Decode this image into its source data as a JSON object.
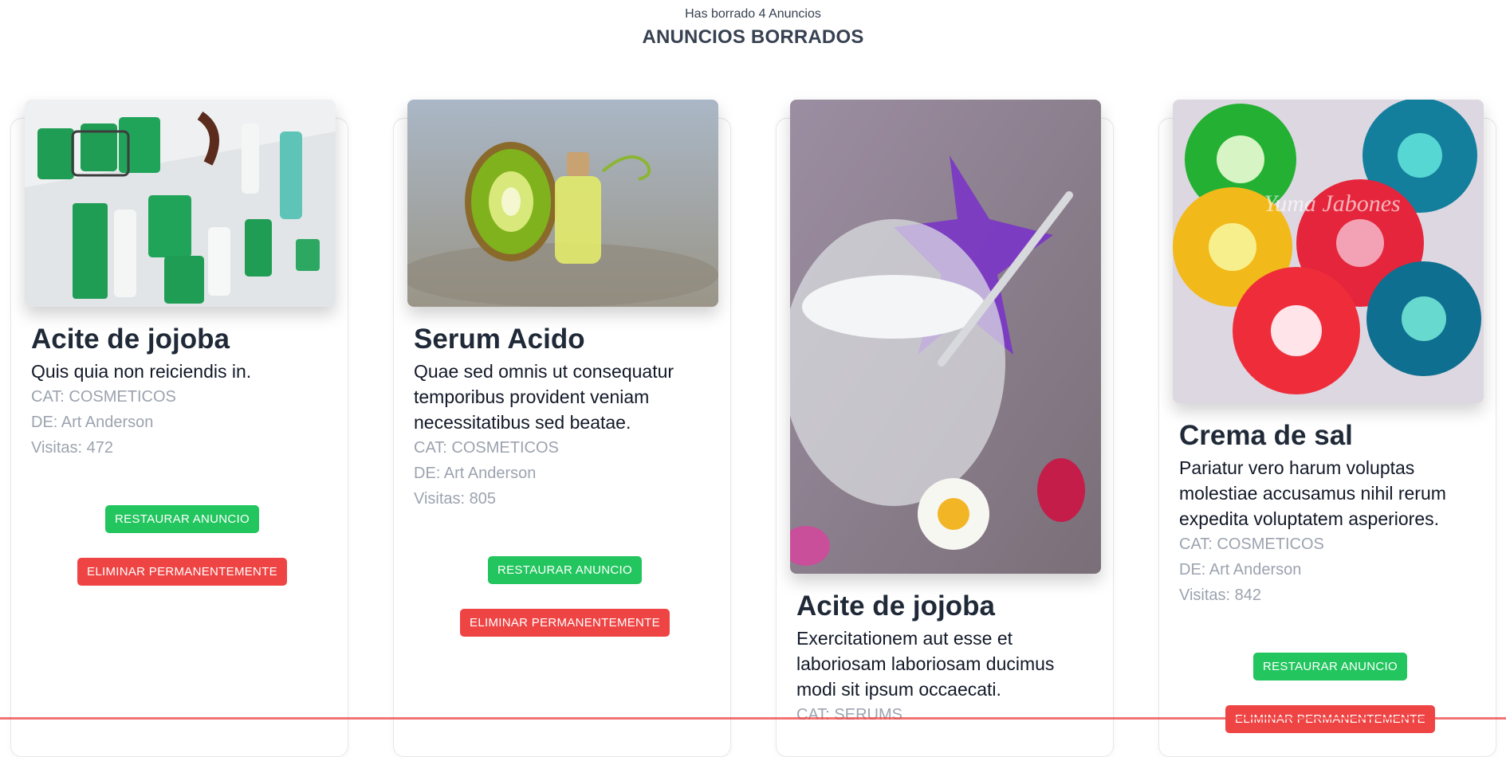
{
  "header": {
    "subtitle": "Has borrado 4 Anuncios",
    "title": "ANUNCIOS BORRADOS"
  },
  "cards": [
    {
      "title": "Acite de jojoba",
      "description": "Quis quia non reiciendis in.",
      "category": "CAT: COSMETICOS",
      "author": "DE: Art Anderson",
      "visits": "Visitas: 472",
      "restore_label": "RESTAURAR ANUNCIO",
      "delete_label": "ELIMINAR PERMANENTEMENTE",
      "image": "pet-products-image"
    },
    {
      "title": "Serum Acido",
      "description": "Quae sed omnis ut consequatur temporibus provident veniam necessitatibus sed beatae.",
      "category": "CAT: COSMETICOS",
      "author": "DE: Art Anderson",
      "visits": "Visitas: 805",
      "restore_label": "RESTAURAR ANUNCIO",
      "delete_label": "ELIMINAR PERMANENTEMENTE",
      "image": "kiwi-oil-image"
    },
    {
      "title": "Acite de jojoba",
      "description": "Exercitationem aut esse et laboriosam laboriosam ducimus modi sit ipsum occaecati.",
      "category": "CAT: SERUMS",
      "image": "cream-jar-image"
    },
    {
      "title": "Crema de sal",
      "description": "Pariatur vero harum voluptas molestiae accusamus nihil rerum expedita voluptatem asperiores.",
      "category": "CAT: COSMETICOS",
      "author": "DE: Art Anderson",
      "visits": "Visitas: 842",
      "restore_label": "RESTAURAR ANUNCIO",
      "delete_label": "ELIMINAR PERMANENTEMENTE",
      "image": "soaps-image",
      "image_watermark": "Yuma Jabones"
    }
  ],
  "colors": {
    "restore": "#22c55e",
    "delete": "#ef4444",
    "meta": "#9ca3af"
  }
}
